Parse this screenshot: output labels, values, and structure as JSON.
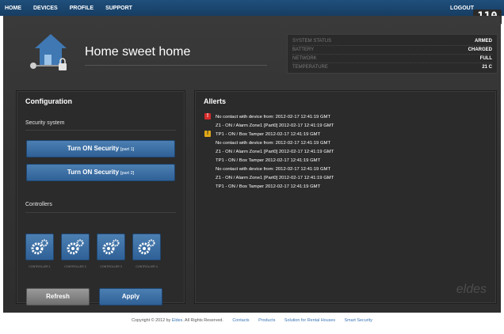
{
  "nav": {
    "items": [
      "HOME",
      "DEVICES",
      "PROFILE",
      "SUPPORT"
    ],
    "logout": "LOGOUT"
  },
  "badge": "110",
  "header": {
    "title": "Home sweet home"
  },
  "status": {
    "rows": [
      {
        "key": "SYSTEM STATUS",
        "value": "ARMED"
      },
      {
        "key": "BATTERY",
        "value": "CHARGED"
      },
      {
        "key": "NETWORK",
        "value": "FULL"
      },
      {
        "key": "TEMPERATURE",
        "value": "21 C"
      }
    ]
  },
  "config": {
    "title": "Configuration",
    "security_label": "Security system",
    "btn1": {
      "label": "Turn ON Security",
      "part": "[part 1]"
    },
    "btn2": {
      "label": "Turn ON Security",
      "part": "[part 2]"
    },
    "controllers_label": "Controllers",
    "controllers": [
      "CONTROLLER 1",
      "CONTROLLER 2",
      "CONTROLLER 3",
      "CONTROLLER 4"
    ],
    "refresh": "Refresh",
    "apply": "Apply"
  },
  "alerts": {
    "title": "Allerts",
    "items": [
      {
        "icon": "error-icon",
        "text": "No contact with device from: 2012-02-17 12:41:19 GMT"
      },
      {
        "icon": "",
        "text": "Z1 - ON / Alarm Zone1 [Part0] 2012-02-17 12:41:19 GMT"
      },
      {
        "icon": "warning-icon",
        "text": "TP1 - ON / Box Tamper 2012-02-17 12:41:19 GMT"
      },
      {
        "icon": "",
        "text": "No contact with device from: 2012-02-17 12:41:19 GMT"
      },
      {
        "icon": "",
        "text": "Z1 - ON / Alarm Zone1 [Part0] 2012-02-17 12:41:19 GMT"
      },
      {
        "icon": "",
        "text": "TP1 - ON / Box Tamper 2012-02-17 12:41:19 GMT"
      },
      {
        "icon": "",
        "text": "No contact with device from: 2012-02-17 12:41:19 GMT"
      },
      {
        "icon": "",
        "text": "Z1 - ON / Alarm Zone1 [Part0] 2012-02-17 12:41:19 GMT"
      },
      {
        "icon": "",
        "text": "TP1 - ON / Box Tamper 2012-02-17 12:41:19 GMT"
      }
    ],
    "brand": "eldes"
  },
  "footer": {
    "copyright_prefix": "Copyright © 2012 by ",
    "company": "Eldes",
    "copyright_suffix": ". All Rights Reserved.",
    "links": [
      "Contacts",
      "Products",
      "Solution for Rental Houses",
      "Smart Security"
    ]
  },
  "colors": {
    "nav": "#1f4f7c",
    "button": "#3a6fa6",
    "error": "#d62a2a",
    "warning": "#e0a818"
  }
}
